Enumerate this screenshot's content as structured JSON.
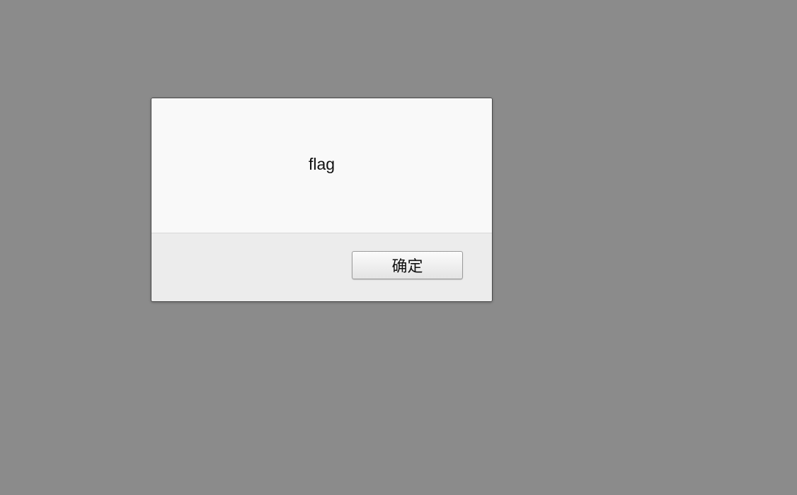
{
  "dialog": {
    "message": "flag",
    "ok_label": "确定"
  }
}
